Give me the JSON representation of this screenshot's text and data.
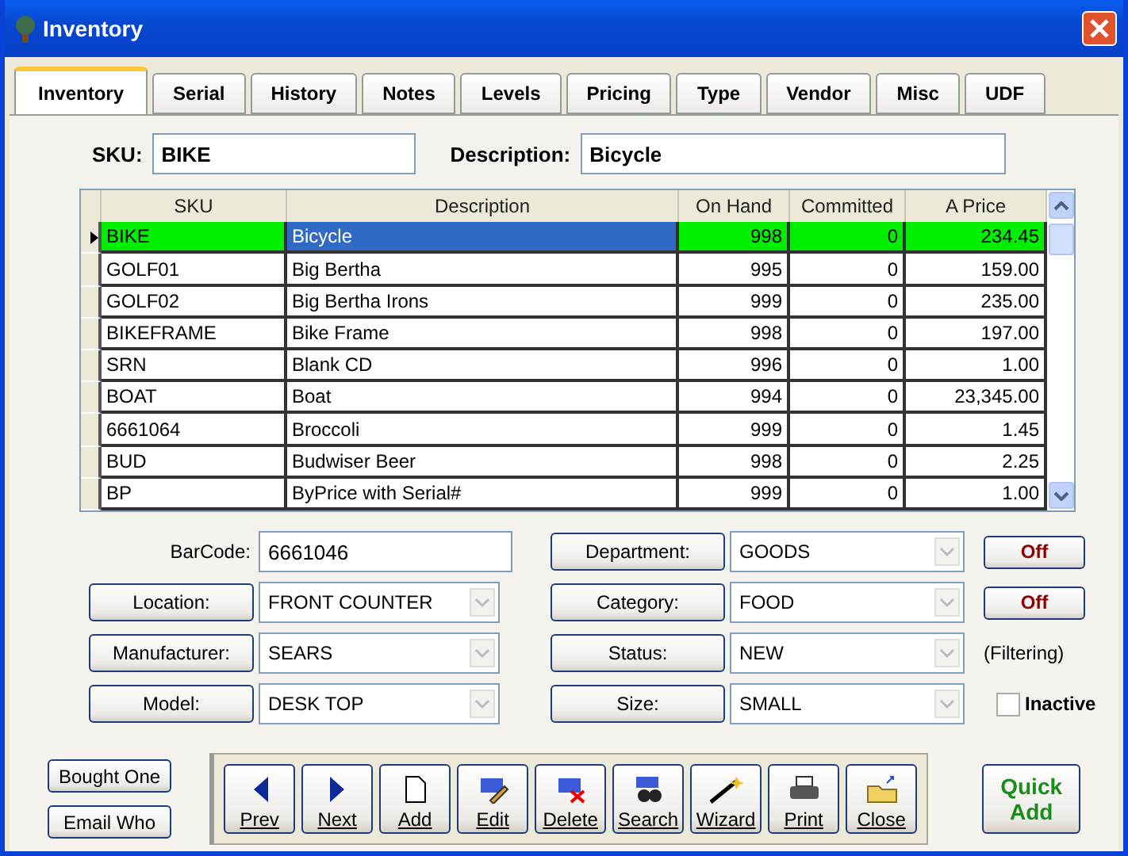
{
  "window": {
    "title": "Inventory"
  },
  "tabs": [
    {
      "label": "Inventory",
      "selected": true
    },
    {
      "label": "Serial",
      "selected": false
    },
    {
      "label": "History",
      "selected": false
    },
    {
      "label": "Notes",
      "selected": false
    },
    {
      "label": "Levels",
      "selected": false
    },
    {
      "label": "Pricing",
      "selected": false
    },
    {
      "label": "Type",
      "selected": false
    },
    {
      "label": "Vendor",
      "selected": false
    },
    {
      "label": "Misc",
      "selected": false
    },
    {
      "label": "UDF",
      "selected": false
    }
  ],
  "header_fields": [
    {
      "label": "SKU:",
      "value": "BIKE"
    },
    {
      "label": "Description:",
      "value": "Bicycle"
    }
  ],
  "table": {
    "columns": [
      "SKU",
      "Description",
      "On Hand",
      "Committed",
      "A Price"
    ],
    "rows": [
      {
        "cells": [
          "BIKE",
          "Bicycle",
          "998",
          "0",
          "234.45"
        ],
        "selected": true
      },
      {
        "cells": [
          "GOLF01",
          "Big Bertha",
          "995",
          "0",
          "159.00"
        ],
        "selected": false
      },
      {
        "cells": [
          "GOLF02",
          "Big Bertha Irons",
          "999",
          "0",
          "235.00"
        ],
        "selected": false
      },
      {
        "cells": [
          "BIKEFRAME",
          "Bike Frame",
          "998",
          "0",
          "197.00"
        ],
        "selected": false
      },
      {
        "cells": [
          "SRN",
          "Blank CD",
          "996",
          "0",
          "1.00"
        ],
        "selected": false
      },
      {
        "cells": [
          "BOAT",
          "Boat",
          "994",
          "0",
          "23,345.00"
        ],
        "selected": false
      },
      {
        "cells": [
          "6661064",
          "Broccoli",
          "999",
          "0",
          "1.45"
        ],
        "selected": false
      },
      {
        "cells": [
          "BUD",
          "Budwiser Beer",
          "998",
          "0",
          "2.25"
        ],
        "selected": false
      },
      {
        "cells": [
          "BP",
          "ByPrice with Serial#",
          "999",
          "0",
          "1.00"
        ],
        "selected": false
      }
    ]
  },
  "left_fields": [
    {
      "label": "BarCode:",
      "value": "6661046",
      "kind": "text"
    },
    {
      "label": "Location:",
      "value": "FRONT COUNTER",
      "kind": "combo"
    },
    {
      "label": "Manufacturer:",
      "value": "SEARS",
      "kind": "combo"
    },
    {
      "label": "Model:",
      "value": "DESK TOP",
      "kind": "combo"
    }
  ],
  "right_fields": [
    {
      "label": "Department:",
      "value": "GOODS"
    },
    {
      "label": "Category:",
      "value": "FOOD"
    },
    {
      "label": "Status:",
      "value": "NEW"
    },
    {
      "label": "Size:",
      "value": "SMALL"
    }
  ],
  "filter_buttons": [
    "Off",
    "Off"
  ],
  "filtering_note": "(Filtering)",
  "inactive": {
    "label": "Inactive",
    "checked": false
  },
  "side_buttons": [
    "Bought One",
    "Email Who"
  ],
  "toolbar": [
    {
      "label": "Prev",
      "kind": "prev"
    },
    {
      "label": "Next",
      "kind": "next"
    },
    {
      "label": "Add",
      "kind": "add"
    },
    {
      "label": "Edit",
      "kind": "edit"
    },
    {
      "label": "Delete",
      "kind": "delete"
    },
    {
      "label": "Search",
      "kind": "search"
    },
    {
      "label": "Wizard",
      "kind": "wizard"
    },
    {
      "label": "Print",
      "kind": "print"
    },
    {
      "label": "Close",
      "kind": "close"
    }
  ],
  "quick_add": "Quick Add"
}
